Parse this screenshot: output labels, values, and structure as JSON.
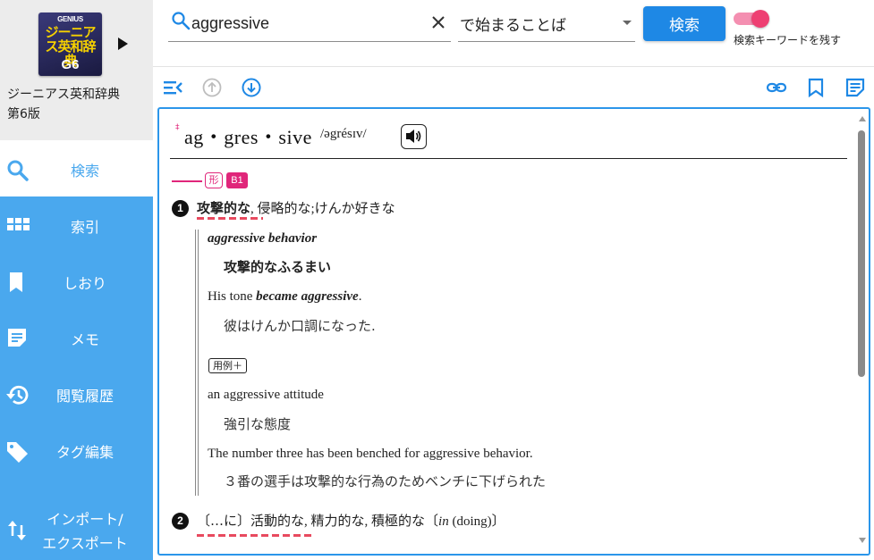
{
  "sidebar": {
    "dictionary": {
      "cover_brand": "GENIUS",
      "cover_title": "ジーニアス英和辞典",
      "cover_edition": "G6",
      "name_line1": "ジーニアス英和辞典",
      "name_line2": "第6版"
    },
    "items": [
      {
        "label": "検索",
        "icon": "search-icon",
        "active": true
      },
      {
        "label": "索引",
        "icon": "grid-icon",
        "active": false
      },
      {
        "label": "しおり",
        "icon": "bookmark-icon",
        "active": false
      },
      {
        "label": "メモ",
        "icon": "memo-icon",
        "active": false
      },
      {
        "label": "閲覧履歴",
        "icon": "history-icon",
        "active": false
      },
      {
        "label": "タグ編集",
        "icon": "tag-icon",
        "active": false
      },
      {
        "label": "インポート/",
        "label2": "エクスポート",
        "icon": "import-export-icon",
        "active": false
      }
    ]
  },
  "search": {
    "query": "aggressive",
    "mode": "で始まることば",
    "button_label": "検索",
    "keep_keyword_label": "検索キーワードを残す",
    "keep_keyword_on": true
  },
  "toolbar": {
    "icons": [
      "toc-icon",
      "arrow-up-circle-icon",
      "arrow-down-circle-icon",
      "link-icon",
      "bookmark-icon",
      "memo-icon"
    ]
  },
  "entry": {
    "headword": "ag・gres・sive",
    "headword_mark": "‡",
    "pronunciation": "/əgrésɪv/",
    "pos": "形",
    "level": "B1",
    "senses": [
      {
        "number": "1",
        "head": "攻撃的な",
        "rest": ", 侵略的な;けんか好きな",
        "examples": [
          {
            "en": "aggressive behavior",
            "jp": "攻撃的なふるまい"
          },
          {
            "en_pre": "His tone ",
            "en_em": "became aggressive",
            "en_post": ".",
            "jp": "彼はけんか口調になった."
          },
          {
            "en": "an aggressive attitude",
            "jp": "強引な態度"
          },
          {
            "en": "The number three has been benched for aggressive behavior.",
            "jp": "３番の選手は攻撃的な行為のためベンチに下げられた"
          }
        ],
        "more_examples_label": "用例＋"
      },
      {
        "number": "2",
        "head": "〔…に〕活動的な",
        "rest_pre": ", 精力的な, 積極的な〔",
        "rest_em": "in",
        "rest_post": " (doing)〕"
      }
    ]
  },
  "colors": {
    "sidebar_bg": "#4aa8ee",
    "accent_blue": "#1e88e5",
    "accent_pink": "#e0267a"
  }
}
